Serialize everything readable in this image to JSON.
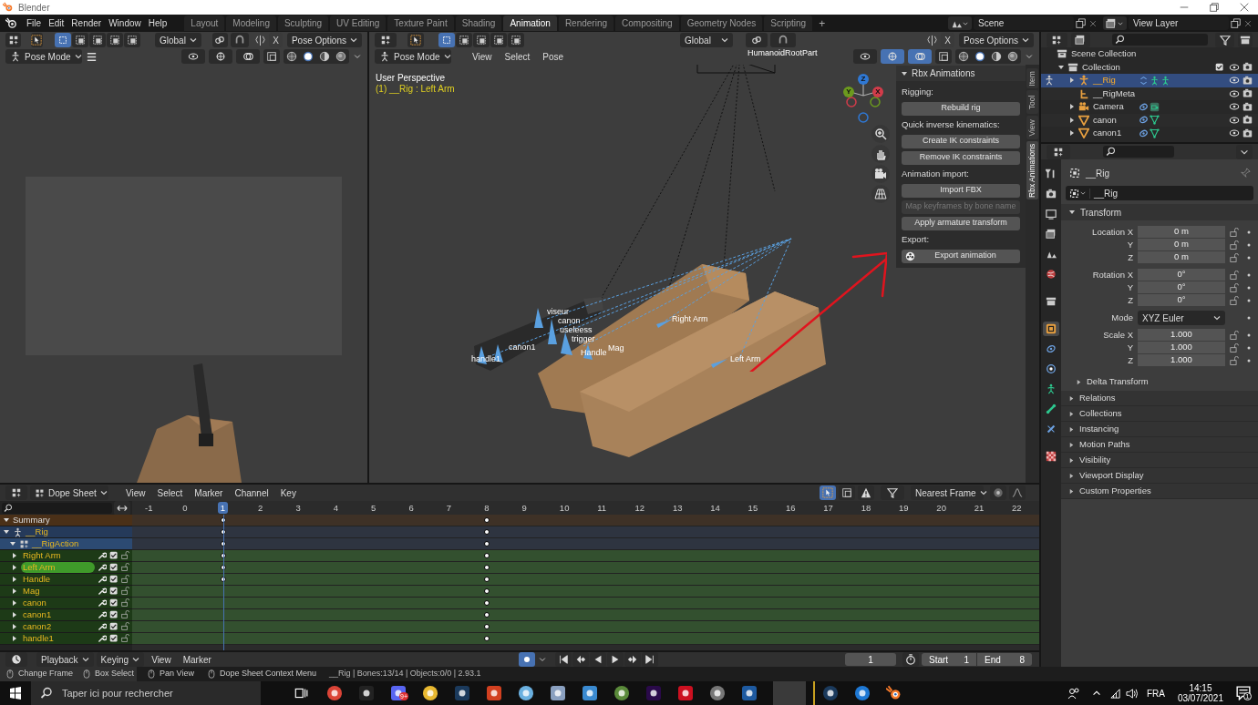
{
  "window": {
    "title": "Blender"
  },
  "menu": [
    "File",
    "Edit",
    "Render",
    "Window",
    "Help"
  ],
  "workspaces": [
    {
      "label": "Layout",
      "selected": false
    },
    {
      "label": "Modeling",
      "selected": false
    },
    {
      "label": "Sculpting",
      "selected": false
    },
    {
      "label": "UV Editing",
      "selected": false
    },
    {
      "label": "Texture Paint",
      "selected": false
    },
    {
      "label": "Shading",
      "selected": false
    },
    {
      "label": "Animation",
      "selected": true
    },
    {
      "label": "Rendering",
      "selected": false
    },
    {
      "label": "Compositing",
      "selected": false
    },
    {
      "label": "Geometry Nodes",
      "selected": false
    },
    {
      "label": "Scripting",
      "selected": false
    }
  ],
  "add_workspace": "+",
  "scene": "Scene",
  "view_layer": "View Layer",
  "left_view": {
    "orientation": "Global",
    "mirror_label": "X",
    "options": "Pose Options",
    "mode": "Pose Mode"
  },
  "main_view": {
    "orientation": "Global",
    "mirror_label": "X",
    "options": "Pose Options",
    "mode": "Pose Mode",
    "menus": [
      "View",
      "Select",
      "Pose"
    ],
    "perspective": "User Perspective",
    "context": "(1) __Rig : Left Arm",
    "root_bone": "HumanoidRootPart",
    "bones": [
      "viseur",
      "canon",
      "useleess",
      "trigger",
      "handle1",
      "canon1",
      "Handle",
      "Mag",
      "Right Arm",
      "Left Arm"
    ],
    "axes": [
      {
        "label": "Z",
        "color": "#2f78d4"
      },
      {
        "label": "Y",
        "color": "#6c9a1e"
      },
      {
        "label": "X",
        "color": "#d23c4a"
      }
    ]
  },
  "side_tabs": [
    {
      "label": "Item",
      "selected": false
    },
    {
      "label": "Tool",
      "selected": false
    },
    {
      "label": "View",
      "selected": false
    },
    {
      "label": "Rbx Animations",
      "selected": true
    }
  ],
  "rbx_panel": {
    "title": "Rbx Animations",
    "expanded": true,
    "items": [
      {
        "kind": "heading",
        "label": "Rigging:"
      },
      {
        "kind": "button",
        "label": "Rebuild rig",
        "disabled": false
      },
      {
        "kind": "heading",
        "label": "Quick inverse kinematics:"
      },
      {
        "kind": "button",
        "label": "Create IK constraints",
        "disabled": false
      },
      {
        "kind": "button",
        "label": "Remove IK constraints",
        "disabled": false
      },
      {
        "kind": "heading",
        "label": "Animation import:"
      },
      {
        "kind": "button",
        "label": "Import FBX",
        "disabled": false
      },
      {
        "kind": "button",
        "label": "Map keyframes by bone name",
        "disabled": true
      },
      {
        "kind": "button",
        "label": "Apply armature transform",
        "disabled": false
      },
      {
        "kind": "heading",
        "label": "Export:"
      },
      {
        "kind": "icon_button",
        "label": "Export animation",
        "disabled": false
      }
    ]
  },
  "outliner": {
    "items": [
      {
        "label": "Scene Collection",
        "kind": "scene_collection",
        "children": [
          {
            "label": "Collection",
            "kind": "collection",
            "expanded": true,
            "checked": true,
            "visible": true,
            "children": [
              {
                "label": "__Rig",
                "kind": "armature",
                "expanded": false,
                "selected": true,
                "visible": true
              },
              {
                "label": "__RigMeta",
                "kind": "bones",
                "selected": false,
                "visible": true
              },
              {
                "label": "Camera",
                "kind": "camera",
                "expanded": false,
                "selected": false,
                "visible": true
              },
              {
                "label": "canon",
                "kind": "mesh",
                "expanded": false,
                "selected": false,
                "visible": true
              },
              {
                "label": "canon1",
                "kind": "mesh",
                "expanded": false,
                "selected": false,
                "visible": true
              }
            ]
          }
        ]
      }
    ]
  },
  "property_tabs": [
    {
      "kind": "tool",
      "selected": false
    },
    {
      "kind": "render",
      "selected": false
    },
    {
      "kind": "output",
      "selected": false
    },
    {
      "kind": "viewlayer",
      "selected": false
    },
    {
      "kind": "scene",
      "selected": false
    },
    {
      "kind": "world",
      "selected": false
    },
    {
      "kind": "collection",
      "selected": false
    },
    {
      "kind": "object",
      "selected": true
    },
    {
      "kind": "modifier",
      "selected": false
    },
    {
      "kind": "physics",
      "selected": false
    },
    {
      "kind": "pose",
      "selected": false
    },
    {
      "kind": "bone",
      "selected": false
    },
    {
      "kind": "constraint",
      "selected": false
    },
    {
      "kind": "texture",
      "selected": false
    }
  ],
  "properties": {
    "object": "__Rig",
    "name_field": "__Rig",
    "transform": {
      "title": "Transform",
      "expanded": true,
      "groups": [
        [
          {
            "kind": "number",
            "label": "Location X",
            "value": "0 m"
          },
          {
            "kind": "number",
            "label": "Y",
            "value": "0 m"
          },
          {
            "kind": "number",
            "label": "Z",
            "value": "0 m"
          }
        ],
        [
          {
            "kind": "number",
            "label": "Rotation X",
            "value": "0°"
          },
          {
            "kind": "number",
            "label": "Y",
            "value": "0°"
          },
          {
            "kind": "number",
            "label": "Z",
            "value": "0°"
          }
        ],
        [
          {
            "kind": "dropdown",
            "label": "Mode",
            "value": "XYZ Euler"
          }
        ],
        [
          {
            "kind": "number",
            "label": "Scale X",
            "value": "1.000"
          },
          {
            "kind": "number",
            "label": "Y",
            "value": "1.000"
          },
          {
            "kind": "number",
            "label": "Z",
            "value": "1.000"
          }
        ]
      ]
    },
    "panels": [
      {
        "label": "Delta Transform",
        "kind": "sub",
        "expanded": false
      },
      {
        "label": "Relations",
        "kind": "main",
        "expanded": false
      },
      {
        "label": "Collections",
        "kind": "main",
        "expanded": false
      },
      {
        "label": "Instancing",
        "kind": "main",
        "expanded": false
      },
      {
        "label": "Motion Paths",
        "kind": "main",
        "expanded": false
      },
      {
        "label": "Visibility",
        "kind": "main",
        "expanded": false
      },
      {
        "label": "Viewport Display",
        "kind": "main",
        "expanded": false
      },
      {
        "label": "Custom Properties",
        "kind": "main",
        "expanded": false
      }
    ]
  },
  "dope_sheet": {
    "mode": "Dope Sheet",
    "menus": [
      "View",
      "Select",
      "Marker",
      "Channel",
      "Key"
    ],
    "snap": "Nearest Frame",
    "frames": [
      {
        "label": "-1",
        "selected": false
      },
      {
        "label": "0",
        "selected": false
      },
      {
        "label": "1",
        "selected": true
      },
      {
        "label": "2",
        "selected": false
      },
      {
        "label": "3",
        "selected": false
      },
      {
        "label": "4",
        "selected": false
      },
      {
        "label": "5",
        "selected": false
      },
      {
        "label": "6",
        "selected": false
      },
      {
        "label": "7",
        "selected": false
      },
      {
        "label": "8",
        "selected": false
      },
      {
        "label": "9",
        "selected": false
      },
      {
        "label": "10",
        "selected": false
      },
      {
        "label": "11",
        "selected": false
      },
      {
        "label": "12",
        "selected": false
      },
      {
        "label": "13",
        "selected": false
      },
      {
        "label": "14",
        "selected": false
      },
      {
        "label": "15",
        "selected": false
      },
      {
        "label": "16",
        "selected": false
      },
      {
        "label": "17",
        "selected": false
      },
      {
        "label": "18",
        "selected": false
      },
      {
        "label": "19",
        "selected": false
      },
      {
        "label": "20",
        "selected": false
      },
      {
        "label": "21",
        "selected": false
      },
      {
        "label": "22",
        "selected": false
      }
    ],
    "channels": [
      {
        "kind": "summary",
        "label": "Summary",
        "expanded": true,
        "key_at_1": true,
        "key_at_8": true
      },
      {
        "kind": "object",
        "label": "__Rig",
        "expanded": true,
        "key_at_1": true,
        "key_at_8": true
      },
      {
        "kind": "action",
        "label": "__RigAction",
        "expanded": true,
        "key_at_1": true,
        "key_at_8": true
      },
      {
        "kind": "bone",
        "label": "Right Arm",
        "expanded": false,
        "selected": false,
        "checked": true,
        "key_at_1": true,
        "key_at_8": true
      },
      {
        "kind": "bone",
        "label": "Left Arm",
        "expanded": false,
        "selected": true,
        "checked": true,
        "key_at_1": true,
        "key_at_8": true
      },
      {
        "kind": "bone",
        "label": "Handle",
        "expanded": false,
        "selected": false,
        "checked": true,
        "key_at_1": true,
        "key_at_8": true
      },
      {
        "kind": "bone",
        "label": "Mag",
        "expanded": false,
        "selected": false,
        "checked": true,
        "key_at_1": false,
        "key_at_8": true
      },
      {
        "kind": "bone",
        "label": "canon",
        "expanded": false,
        "selected": false,
        "checked": true,
        "key_at_1": false,
        "key_at_8": true
      },
      {
        "kind": "bone",
        "label": "canon1",
        "expanded": false,
        "selected": false,
        "checked": true,
        "key_at_1": false,
        "key_at_8": true
      },
      {
        "kind": "bone",
        "label": "canon2",
        "expanded": false,
        "selected": false,
        "checked": true,
        "key_at_1": false,
        "key_at_8": true
      },
      {
        "kind": "bone",
        "label": "handle1",
        "expanded": false,
        "selected": false,
        "checked": true,
        "key_at_1": false,
        "key_at_8": true
      }
    ]
  },
  "timeline": {
    "menus": [
      "Playback",
      "Keying",
      "View",
      "Marker"
    ],
    "current_frame": "1",
    "start_label": "Start",
    "start": "1",
    "end_label": "End",
    "end": "8"
  },
  "status_bar": {
    "hints": [
      "Change Frame",
      "Box Select",
      "Pan View",
      "Dope Sheet Context Menu"
    ],
    "stats": "__Rig | Bones:13/14 | Objects:0/0 | 2.93.1"
  },
  "taskbar": {
    "search_placeholder": "Taper ici pour rechercher",
    "badge": "9+",
    "language": "FRA",
    "time": "14:15",
    "date": "03/07/2021",
    "notifications": "1"
  }
}
